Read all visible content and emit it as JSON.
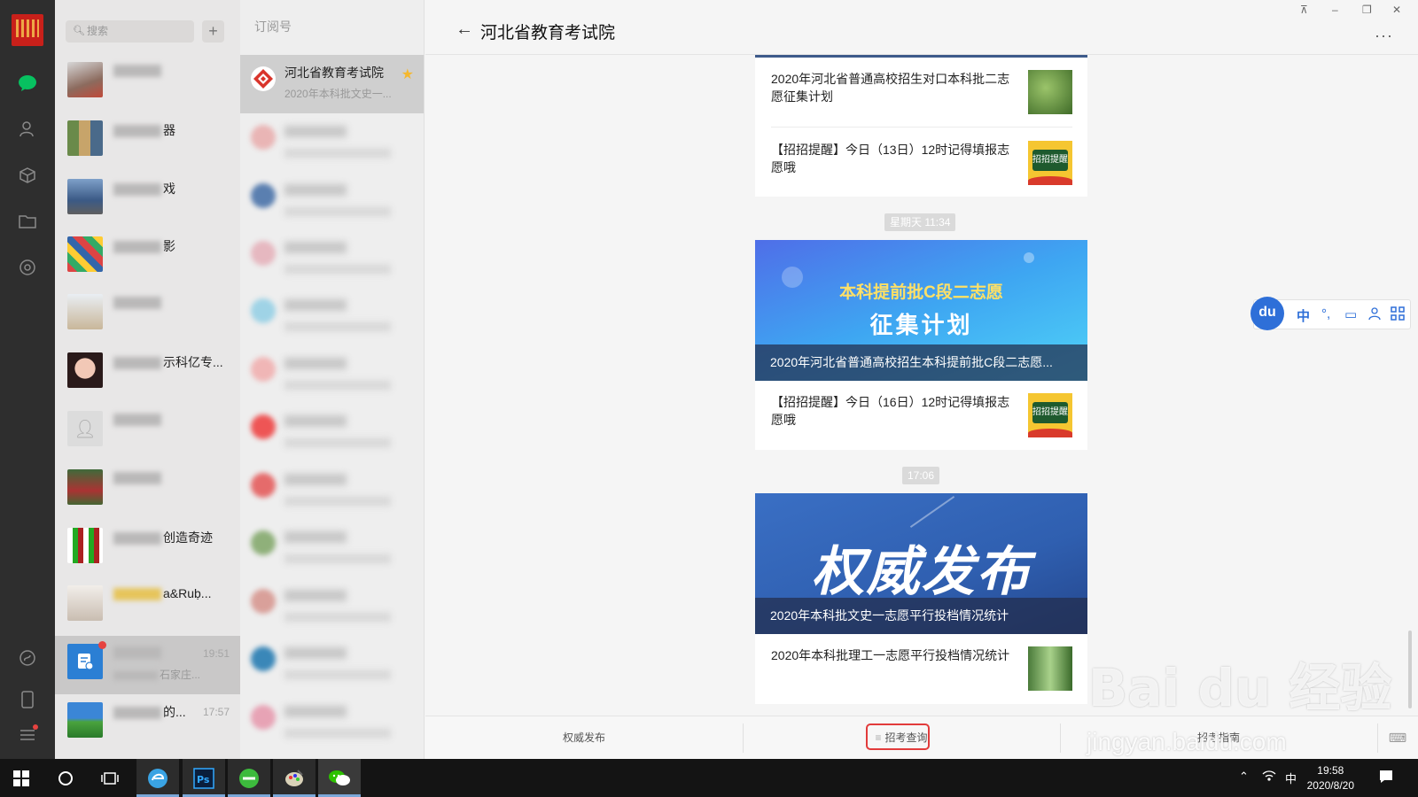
{
  "app": {
    "title": "河北省教育考试院",
    "window_controls": [
      "⊼",
      "–",
      "❐",
      "✕"
    ],
    "more": "···"
  },
  "search": {
    "placeholder": "搜索",
    "add_label": "+"
  },
  "chat_list": [
    {
      "name_visible": "",
      "time": "",
      "preview": ""
    },
    {
      "name_visible": "器",
      "time": "",
      "preview": ""
    },
    {
      "name_visible": "戏",
      "time": "",
      "preview": ""
    },
    {
      "name_visible": "影",
      "time": "",
      "preview": ""
    },
    {
      "name_visible": "",
      "time": "",
      "preview": ""
    },
    {
      "name_visible": "示科亿专...",
      "time": "",
      "preview": ""
    },
    {
      "name_visible": "",
      "time": "",
      "preview": ""
    },
    {
      "name_visible": "",
      "time": "",
      "preview": ""
    },
    {
      "name_visible": "创造奇迹",
      "time": "",
      "preview": ""
    },
    {
      "name_visible": "a&Ruḅ...",
      "time": "",
      "preview": ""
    },
    {
      "name_visible": "",
      "time": "19:51",
      "preview": "石家庄..."
    },
    {
      "name_visible": "的...",
      "time": "17:57",
      "preview": ""
    }
  ],
  "subscriptions": {
    "header": "订阅号",
    "selected": {
      "name": "河北省教育考试院",
      "preview": "2020年本科批文史一..."
    }
  },
  "messages": {
    "card1": [
      {
        "text": "2020年河北省普通高校招生对口本科批二志愿征集计划"
      },
      {
        "text": "【招招提醒】今日（13日）12时记得填报志愿哦"
      }
    ],
    "timestamp1": "星期天 11:34",
    "card2": {
      "hero_title_line1": "本科提前批C段二志愿",
      "hero_title_line2": "征集计划",
      "hero_caption": "2020年河北省普通高校招生本科提前批C段二志愿...",
      "rows": [
        {
          "text": "【招招提醒】今日（16日）12时记得填报志愿哦"
        }
      ]
    },
    "timestamp2": "17:06",
    "card3": {
      "hero_title": "权威发布",
      "hero_caption": "2020年本科批文史一志愿平行投档情况统计",
      "rows": [
        {
          "text": "2020年本科批理工一志愿平行投档情况统计"
        }
      ]
    },
    "thumb_badge": "招招提醒"
  },
  "bottom_menu": {
    "tab1": "权威发布",
    "tab2": "招考查询",
    "tab3": "招考指南",
    "tab2_icon": "≡"
  },
  "du_toolbar": {
    "logo": "du",
    "lang": "中"
  },
  "watermark": {
    "line1": "Bai du 经验",
    "line2": "jingyan.baidu.com"
  },
  "taskbar": {
    "time": "19:58",
    "date": "2020/8/20",
    "ime": "中"
  },
  "colors": {
    "accent_green": "#07c160",
    "highlight_red": "#e23b3b",
    "du_blue": "#2e6fd8",
    "star": "#f5b82e"
  }
}
